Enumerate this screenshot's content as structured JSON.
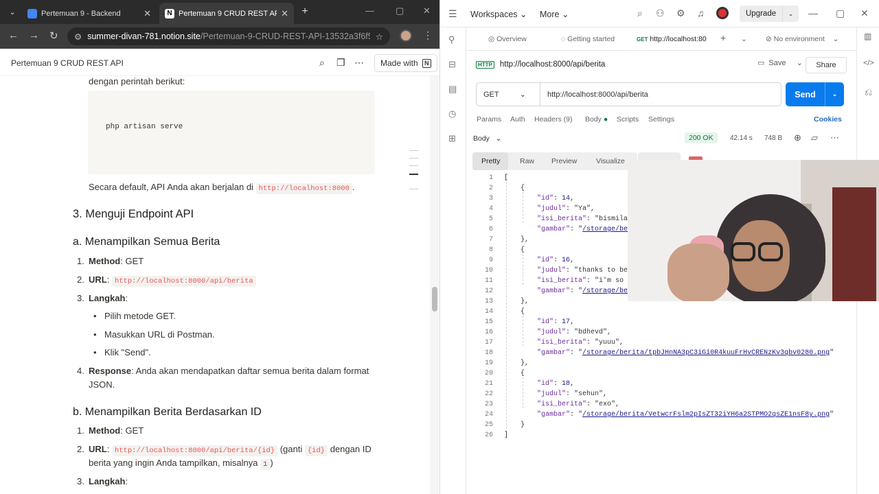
{
  "chrome": {
    "tabs": [
      {
        "title": "Pertemuan 9 - Backend",
        "active": false
      },
      {
        "title": "Pertemuan 9 CRUD REST API",
        "active": true
      }
    ],
    "new_tab": "+",
    "url_host": "summer-divan-781.notion.site",
    "url_path": "/Pertemuan-9-CRUD-REST-API-13532a3f6f54..."
  },
  "notion": {
    "page_title": "Pertemuan 9 CRUD REST API",
    "made_with": "Made with",
    "intro": "dengan perintah berikut:",
    "code": "php artisan serve",
    "default_text": "Secara default, API Anda akan berjalan di",
    "default_url": "http://localhost:8000",
    "h_section3": "3. Menguji Endpoint API",
    "h_a": "a. Menampilkan Semua Berita",
    "a_items": {
      "method_label": "Method",
      "method_value": ": GET",
      "url_label": "URL",
      "url_value": "http://localhost:8000/api/berita",
      "steps_label": "Langkah",
      "steps": [
        "Pilih metode GET.",
        "Masukkan URL di Postman.",
        "Klik \"Send\"."
      ],
      "response_label": "Response",
      "response_text_1": ": Anda akan mendapatkan daftar semua berita dalam format",
      "response_text_2": "JSON."
    },
    "h_b": "b. Menampilkan Berita Berdasarkan ID",
    "b_items": {
      "method_label": "Method",
      "method_value": ": GET",
      "url_label": "URL",
      "url_value": "http://localhost:8000/api/berita/{id}",
      "url_text_1": "(ganti",
      "id_code": "{id}",
      "url_text_2": "dengan ID",
      "url_text_3": "berita yang ingin Anda tampilkan, misalnya",
      "example_id": "1",
      "steps_label": "Langkah"
    }
  },
  "postman": {
    "menu": [
      "Workspaces",
      "More"
    ],
    "upgrade": "Upgrade",
    "tabs": {
      "overview": "Overview",
      "getting_started": "Getting started",
      "request_tab_method": "GET",
      "request_tab_url": "http://localhost:80",
      "environment": "No environment"
    },
    "request_title": "http://localhost:8000/api/berita",
    "save": "Save",
    "share": "Share",
    "method": "GET",
    "url": "http://localhost:8000/api/berita",
    "send": "Send",
    "subtabs": [
      "Params",
      "Auth",
      "Headers (9)",
      "Body",
      "Scripts",
      "Settings"
    ],
    "cookies": "Cookies",
    "response": {
      "body_label": "Body",
      "status": "200 OK",
      "time": "42.14 s",
      "size": "748 B",
      "views": [
        "Pretty",
        "Raw",
        "Preview",
        "Visualize"
      ]
    },
    "json_lines": [
      {
        "n": "1",
        "t": "["
      },
      {
        "n": "2",
        "t": "    {"
      },
      {
        "n": "3",
        "t": "        \"id\": 14,"
      },
      {
        "n": "4",
        "t": "        \"judul\": \"Ya\","
      },
      {
        "n": "5",
        "t": "        \"isi_berita\": \"bismila"
      },
      {
        "n": "6",
        "t": "        \"gambar\": \"/storage/be"
      },
      {
        "n": "7",
        "t": "    },"
      },
      {
        "n": "8",
        "t": "    {"
      },
      {
        "n": "9",
        "t": "        \"id\": 16,"
      },
      {
        "n": "10",
        "t": "        \"judul\": \"thanks to be"
      },
      {
        "n": "11",
        "t": "        \"isi_berita\": \"i'm so"
      },
      {
        "n": "12",
        "t": "        \"gambar\": \"/storage/be"
      },
      {
        "n": "13",
        "t": "    },"
      },
      {
        "n": "14",
        "t": "    {"
      },
      {
        "n": "15",
        "t": "        \"id\": 17,"
      },
      {
        "n": "16",
        "t": "        \"judul\": \"bdhevd\","
      },
      {
        "n": "17",
        "t": "        \"isi_berita\": \"yuuu\","
      },
      {
        "n": "18",
        "t": "        \"gambar\": \"/storage/berita/tpbJHnNA3pC3iGi0R4kuuFrHvCRENzKv3qbv0280.png\""
      },
      {
        "n": "19",
        "t": "    },"
      },
      {
        "n": "20",
        "t": "    {"
      },
      {
        "n": "21",
        "t": "        \"id\": 18,"
      },
      {
        "n": "22",
        "t": "        \"judul\": \"sehun\","
      },
      {
        "n": "23",
        "t": "        \"isi_berita\": \"exo\","
      },
      {
        "n": "24",
        "t": "        \"gambar\": \"/storage/berita/VetwcrFslm2pIsZT32iYH6a2STPMO2qsZE1nsF8y.png\""
      },
      {
        "n": "25",
        "t": "    }"
      },
      {
        "n": "26",
        "t": "]"
      }
    ]
  },
  "colors": {
    "send_blue": "#097bed",
    "status_green": "#0a7b3e",
    "code_red": "#eb5757"
  }
}
